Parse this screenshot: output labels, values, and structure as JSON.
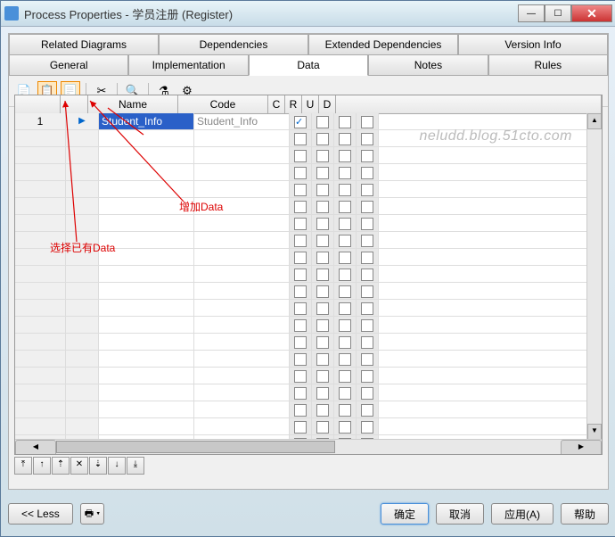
{
  "window": {
    "title": "Process Properties - 学员注册 (Register)"
  },
  "tabs_row1": [
    {
      "label": "Related Diagrams"
    },
    {
      "label": "Dependencies"
    },
    {
      "label": "Extended Dependencies"
    },
    {
      "label": "Version Info"
    }
  ],
  "tabs_row2": [
    {
      "label": "General"
    },
    {
      "label": "Implementation"
    },
    {
      "label": "Data",
      "active": true
    },
    {
      "label": "Notes"
    },
    {
      "label": "Rules"
    }
  ],
  "toolbar_icons": {
    "properties": "📄",
    "select_existing": "📋",
    "add_new": "📃",
    "cut": "✂",
    "find": "🔍",
    "filter": "⚗",
    "customize": "⚙"
  },
  "columns": {
    "name": "Name",
    "code": "Code",
    "c": "C",
    "r": "R",
    "u": "U",
    "d": "D"
  },
  "rows": [
    {
      "num": "1",
      "marker": "▶",
      "name": "Student_Info",
      "code": "Student_Info",
      "c": true,
      "r": false,
      "u": false,
      "d": false
    }
  ],
  "row_nav": {
    "top": "⤒",
    "up": "↑",
    "ins_up": "⇡",
    "del": "✕",
    "ins_down": "⇣",
    "down": "↓",
    "bottom": "⤓"
  },
  "buttons": {
    "less": "<< Less",
    "print": "🖶 ▾",
    "ok": "确定",
    "cancel": "取消",
    "apply": "应用(A)",
    "help": "帮助"
  },
  "annot": {
    "sel": "选择已有Data",
    "add": "增加Data"
  },
  "watermark": "neludd.blog.51cto.com"
}
